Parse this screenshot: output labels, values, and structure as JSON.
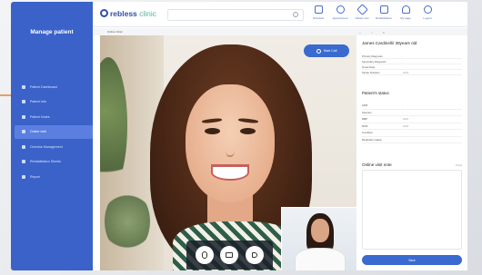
{
  "sidebar": {
    "title": "Manage patient",
    "items": [
      {
        "label": "Patient Dashboard",
        "active": false
      },
      {
        "label": "Patient info",
        "active": false
      },
      {
        "label": "Patient Notes",
        "active": false
      },
      {
        "label": "Online visit",
        "active": true
      },
      {
        "label": "Overdue Management",
        "active": false
      },
      {
        "label": "Rehabilitation Sheets",
        "active": false
      },
      {
        "label": "Report",
        "active": false
      }
    ]
  },
  "header": {
    "logo_brand": "rebless",
    "logo_suffix": "clinic",
    "search_placeholder": "",
    "nav": [
      {
        "label": "Schedule",
        "icon": "calendar-icon"
      },
      {
        "label": "Appointment",
        "icon": "appointment-icon"
      },
      {
        "label": "Patient List",
        "icon": "patient-list-icon"
      },
      {
        "label": "Rehabilitation",
        "icon": "rehabilitation-icon"
      },
      {
        "label": "My page",
        "icon": "user-icon"
      },
      {
        "label": "Logout",
        "icon": "logout-icon"
      }
    ]
  },
  "subbar": {
    "label": "Online Clinic",
    "controls": "– ▫ ×"
  },
  "video": {
    "start_button": "Start Call"
  },
  "patient": {
    "name": "James Cardinelli/ 38years old",
    "details": [
      {
        "key": "Primary Diagnosis",
        "value": ":"
      },
      {
        "key": "Secondary Diagnosis",
        "value": ":"
      },
      {
        "key": "Onset Date",
        "value": ":"
      },
      {
        "key": "Stroke Duration",
        "value": ": 22.5"
      }
    ],
    "status_title": "Patient's status",
    "status": [
      {
        "key": "ADM",
        "value": ":"
      },
      {
        "key": "Infection",
        "value": ":"
      },
      {
        "key": "MBP",
        "value": ": 22.6"
      },
      {
        "key": "MOR",
        "value": ": 22.8"
      },
      {
        "key": "Condition",
        "value": ":"
      },
      {
        "key": "Medication status",
        "value": ":"
      }
    ]
  },
  "notes": {
    "title": "Online visit note",
    "link": "Detail",
    "value": "",
    "save_label": "Save"
  },
  "colors": {
    "sidebar": "#3a62c8",
    "accent": "#3a6ad0",
    "brand_green": "#4bb89a"
  }
}
